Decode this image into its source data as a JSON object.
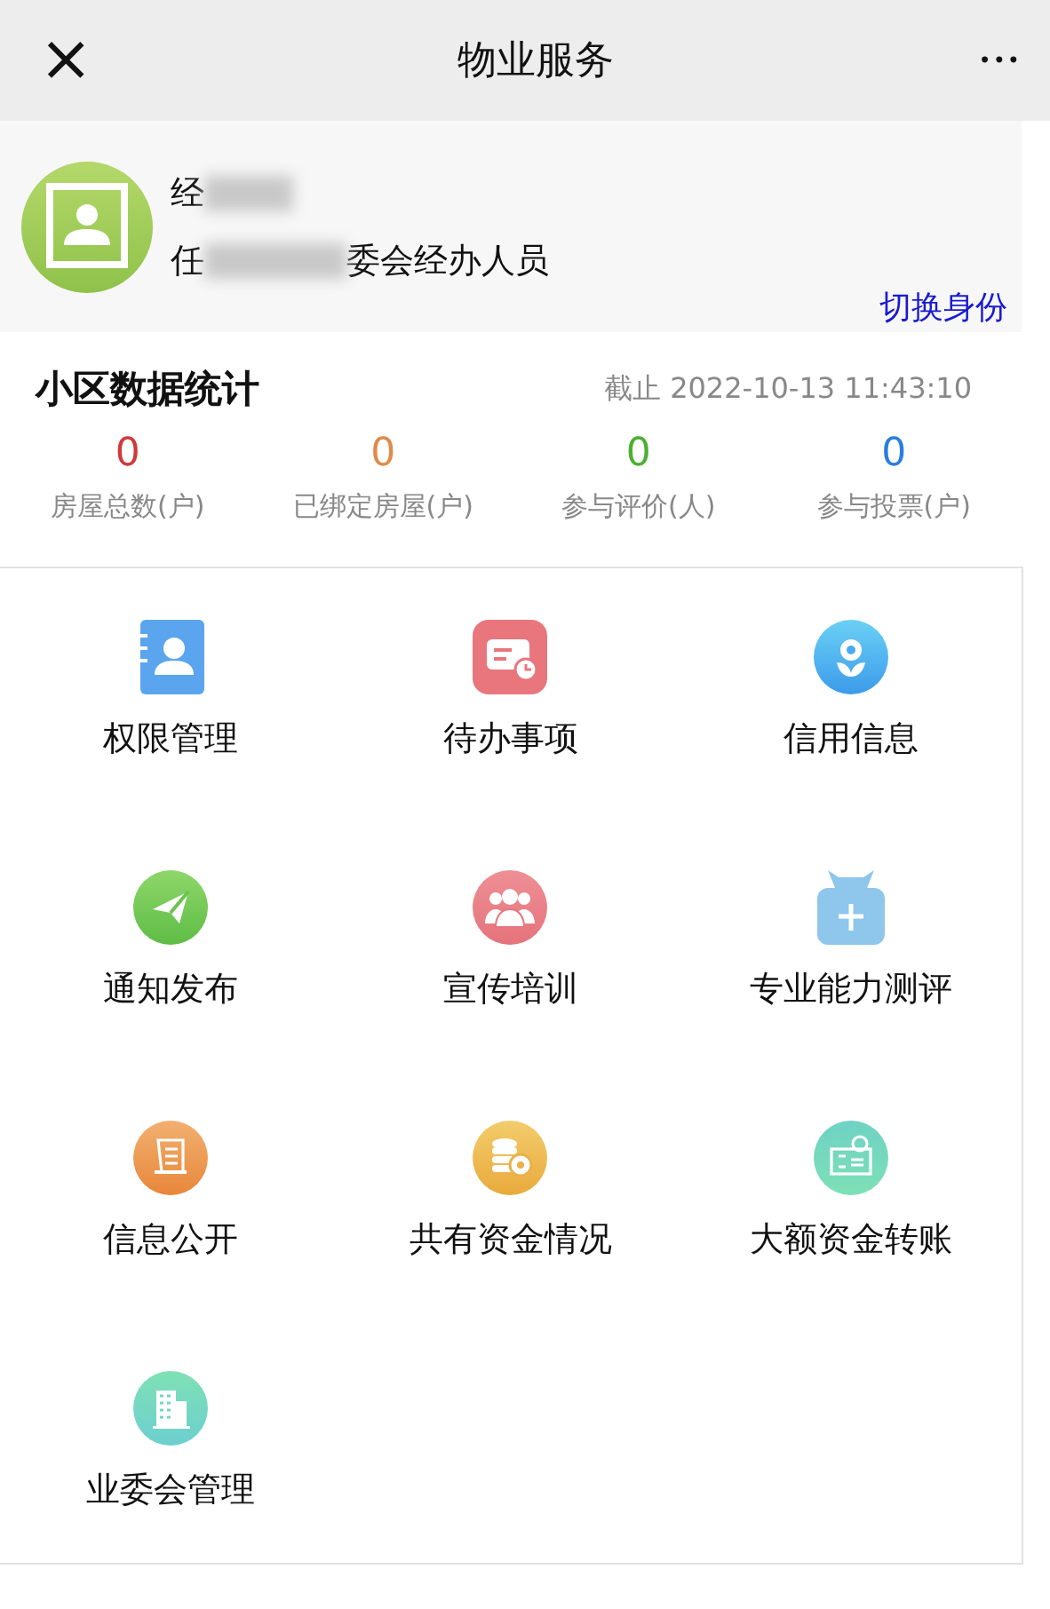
{
  "nav": {
    "title": "物业服务",
    "close": "×",
    "more": "•••"
  },
  "profile": {
    "name": "经",
    "role_prefix": "任",
    "role_suffix": "委会经办人员",
    "switch_link": "切换身份"
  },
  "stats": {
    "title": "小区数据统计",
    "as_of": "截止 2022-10-13 11:43:10",
    "items": [
      {
        "value": "0",
        "label": "房屋总数(户)",
        "color": "#d0393a"
      },
      {
        "value": "0",
        "label": "已绑定房屋(户)",
        "color": "#e08a4a"
      },
      {
        "value": "0",
        "label": "参与评价(人)",
        "color": "#4caf30"
      },
      {
        "value": "0",
        "label": "参与投票(户)",
        "color": "#2a7de1"
      }
    ]
  },
  "services": [
    {
      "label": "权限管理",
      "kind": "contacts"
    },
    {
      "label": "待办事项",
      "kind": "todo"
    },
    {
      "label": "信用信息",
      "kind": "credit"
    },
    {
      "label": "通知发布",
      "kind": "notice"
    },
    {
      "label": "宣传培训",
      "kind": "training"
    },
    {
      "label": "专业能力测评",
      "kind": "bag"
    },
    {
      "label": "信息公开",
      "kind": "scroll"
    },
    {
      "label": "共有资金情况",
      "kind": "coins"
    },
    {
      "label": "大额资金转账",
      "kind": "cheque"
    },
    {
      "label": "业委会管理",
      "kind": "building"
    }
  ]
}
